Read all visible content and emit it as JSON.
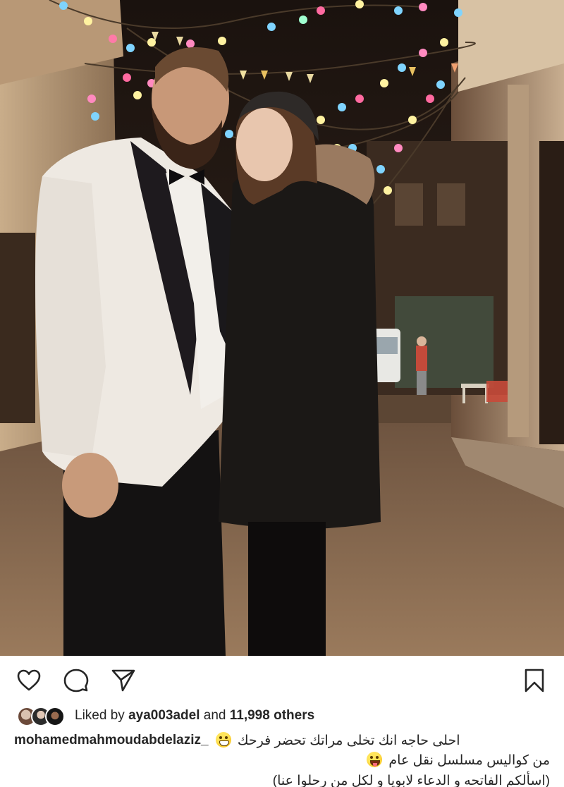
{
  "photo": {
    "description_icon": "photo"
  },
  "actions": {
    "like_icon": "heart-icon",
    "comment_icon": "comment-bubble-icon",
    "share_icon": "paper-plane-icon",
    "save_icon": "bookmark-icon"
  },
  "likes": {
    "prefix": "Liked by",
    "user": "aya003adel",
    "joiner": "and",
    "others": "11,998 others"
  },
  "caption": {
    "username": "mohamedmahmoudabdelaziz_",
    "line1": "احلى حاجه انك تخلى مراتك تحضر فرحك",
    "line2": "من كواليس مسلسل نقل عام",
    "line3": "(اسألكم الفاتحه و الدعاء لابويا و لكل من رحلوا عنا)"
  },
  "colors": {
    "text": "#262626",
    "background": "#ffffff"
  }
}
